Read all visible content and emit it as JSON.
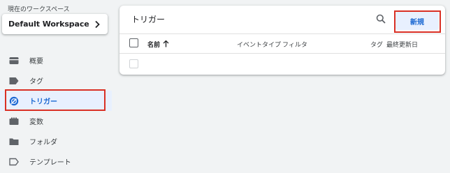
{
  "sidebar": {
    "workspace_caption": "現在のワークスペース",
    "workspace_name": "Default Workspace",
    "items": [
      {
        "label": "概要",
        "icon": "overview-icon"
      },
      {
        "label": "タグ",
        "icon": "tag-icon"
      },
      {
        "label": "トリガー",
        "icon": "trigger-icon",
        "active": true
      },
      {
        "label": "変数",
        "icon": "variable-icon"
      },
      {
        "label": "フォルダ",
        "icon": "folder-icon"
      },
      {
        "label": "テンプレート",
        "icon": "template-icon"
      }
    ]
  },
  "main": {
    "title": "トリガー",
    "new_label": "新規",
    "columns": {
      "name": "名前",
      "event_type": "イベントタイプ",
      "filter": "フィルタ",
      "tag": "タグ",
      "last_updated": "最終更新日"
    },
    "sort_indicator": "ascending"
  },
  "colors": {
    "accent": "#1967d2",
    "active_bg": "#e8f0fe",
    "highlight_outline": "#d93025",
    "icon_gray": "#5f6368"
  }
}
